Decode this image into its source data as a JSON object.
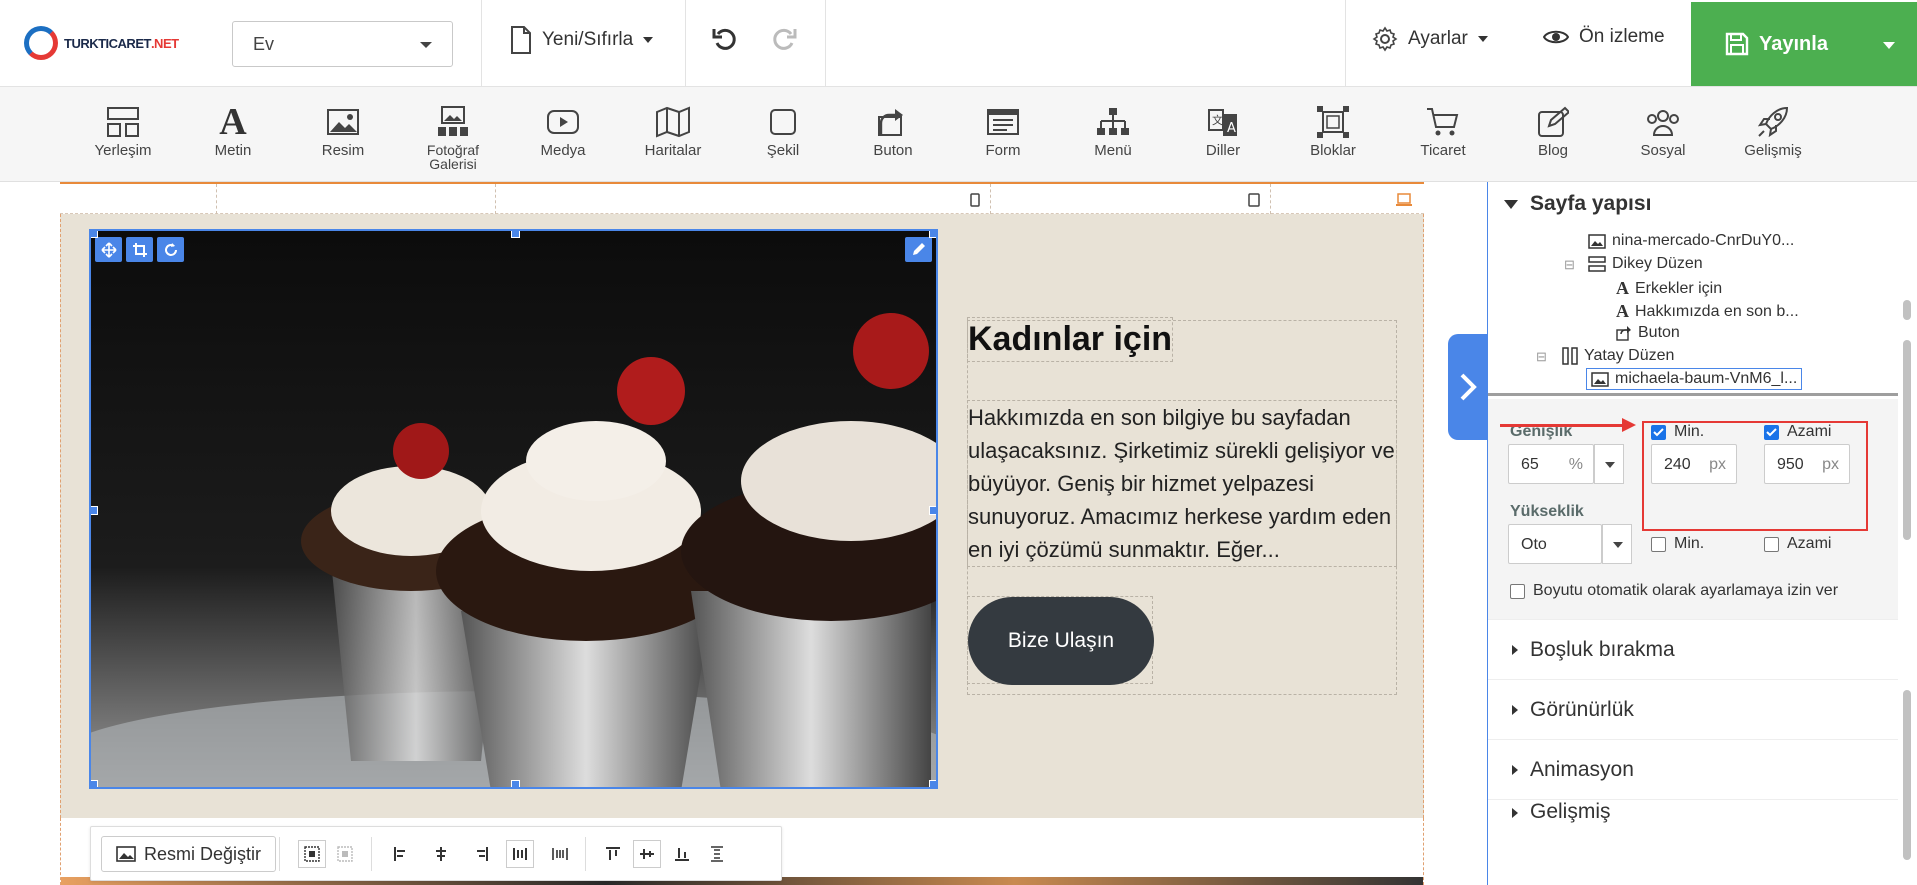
{
  "header": {
    "logo_text": "TURKTICARET",
    "logo_suffix": ".NET",
    "page_select": "Ev",
    "new_reset": "Yeni/Sıfırla",
    "settings": "Ayarlar",
    "preview": "Ön izleme",
    "publish": "Yayınla"
  },
  "toolbar": {
    "items": [
      {
        "label": "Yerleşim",
        "icon": "layout-icon"
      },
      {
        "label": "Metin",
        "icon": "text-icon"
      },
      {
        "label": "Resim",
        "icon": "image-icon"
      },
      {
        "label": "Fotoğraf Galerisi",
        "icon": "gallery-icon"
      },
      {
        "label": "Medya",
        "icon": "media-icon"
      },
      {
        "label": "Haritalar",
        "icon": "map-icon"
      },
      {
        "label": "Şekil",
        "icon": "shape-icon"
      },
      {
        "label": "Buton",
        "icon": "button-icon"
      },
      {
        "label": "Form",
        "icon": "form-icon"
      },
      {
        "label": "Menü",
        "icon": "menu-icon"
      },
      {
        "label": "Diller",
        "icon": "languages-icon"
      },
      {
        "label": "Bloklar",
        "icon": "blocks-icon"
      },
      {
        "label": "Ticaret",
        "icon": "cart-icon"
      },
      {
        "label": "Blog",
        "icon": "blog-icon"
      },
      {
        "label": "Sosyal",
        "icon": "social-icon"
      },
      {
        "label": "Gelişmiş",
        "icon": "rocket-icon"
      }
    ]
  },
  "canvas": {
    "heading": "Kadınlar için",
    "paragraph": "Hakkımızda en son bilgiye bu sayfadan ulaşacaksınız. Şirketimiz sürekli gelişiyor ve büyüyor. Geniş bir hizmet yelpazesi sunuyoruz. Amacımız herkese yardım eden en iyi çözümü sunmaktır. Eğer...",
    "button": "Bize Ulaşın"
  },
  "image_toolbar": {
    "replace": "Resmi Değiştir"
  },
  "panel": {
    "title": "Sayfa yapısı",
    "tree": [
      {
        "label": "nina-mercado-CnrDuY0...",
        "icon": "image-icon"
      },
      {
        "label": "Dikey Düzen",
        "icon": "vertical-layout-icon"
      },
      {
        "label": "Erkekler için",
        "icon": "text-icon"
      },
      {
        "label": "Hakkımızda en son b...",
        "icon": "text-icon"
      },
      {
        "label": "Buton",
        "icon": "button-icon"
      },
      {
        "label": "Yatay Düzen",
        "icon": "horizontal-layout-icon"
      },
      {
        "label": "michaela-baum-VnM6_l...",
        "icon": "image-icon"
      }
    ],
    "width": {
      "label": "Genişlik",
      "value": "65",
      "unit": "%",
      "min_label": "Min.",
      "min_value": "240",
      "min_unit": "px",
      "max_label": "Azami",
      "max_value": "950",
      "max_unit": "px"
    },
    "height": {
      "label": "Yükseklik",
      "value": "Oto",
      "min_label": "Min.",
      "max_label": "Azami"
    },
    "auto_resize": "Boyutu otomatik olarak ayarlamaya izin ver",
    "sections": [
      "Boşluk bırakma",
      "Görünürlük",
      "Animasyon",
      "Gelişmiş"
    ]
  },
  "colors": {
    "accent": "#4a86e8",
    "publish": "#4caf50",
    "highlight": "#e53935"
  }
}
